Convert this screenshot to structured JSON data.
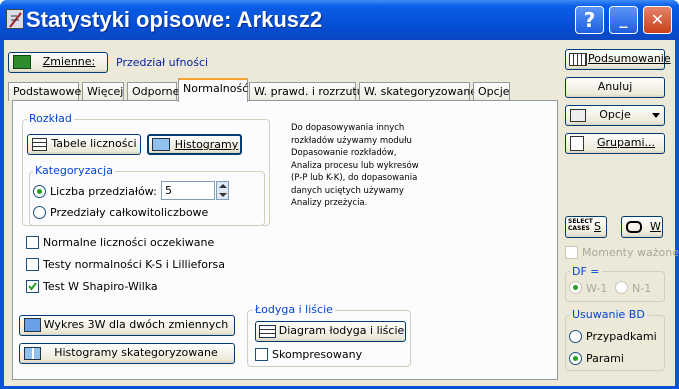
{
  "window": {
    "title": "Statystyki opisowe: Arkusz2"
  },
  "titlebar": {
    "help": "?",
    "minimize": "_",
    "close": "✕"
  },
  "vars": {
    "button": "Zmienne:",
    "selected": "Przedział ufności"
  },
  "tabs": [
    "Podstawowe",
    "Więcej",
    "Odporne",
    "Normalność",
    "W. prawd. i rozrzutu",
    "W. skategoryzowane",
    "Opcje"
  ],
  "rozklad": {
    "title": "Rozkład",
    "tabele": "Tabele liczności",
    "histogramy": "Histogramy"
  },
  "kategoryzacja": {
    "title": "Kategoryzacja",
    "liczba_label": "Liczba przedziałów:",
    "liczba_value": "5",
    "przedzialy": "Przedziały całkowitoliczbowe"
  },
  "description": "Do dopasowywania innych\nrozkładów używamy modułu\nDopasowanie rozkładów,\nAnaliza procesu lub wykresów\n(P-P lub K-K), do dopasowania\ndanych uciętych używamy\nAnalizy przeżycia.",
  "checks": {
    "normalne": "Normalne liczności oczekiwane",
    "testy": "Testy normalności  K-S i Lillieforsa",
    "shapiro": "Test W Shapiro-Wilka"
  },
  "bottom": {
    "wykres3w": "Wykres 3W  dla dwóch zmiennych",
    "histogramy_skat": "Histogramy skategoryzowane"
  },
  "lodyga": {
    "title": "Łodyga i liście",
    "diagram": "Diagram łodyga i liście",
    "skompresowany": "Skompresowany"
  },
  "right": {
    "podsumowanie": "Podsumowanie",
    "anuluj": "Anuluj",
    "opcje": "Opcje",
    "grupami": "Grupami...",
    "select_cases_icon": "SELECT CASES",
    "select_s": "S",
    "w_label": "W",
    "momenty": "Momenty ważone"
  },
  "df": {
    "title": "DF =",
    "w1": "W-1",
    "n1": "N-1"
  },
  "usuwanie": {
    "title": "Usuwanie BD",
    "przypadkami": "Przypadkami",
    "parami": "Parami"
  },
  "states": {
    "przedzialy_radio": "Liczba przedziałów",
    "shapiro_checked": true,
    "usuwanie_selected": "Parami",
    "df_selected": "W-1"
  }
}
